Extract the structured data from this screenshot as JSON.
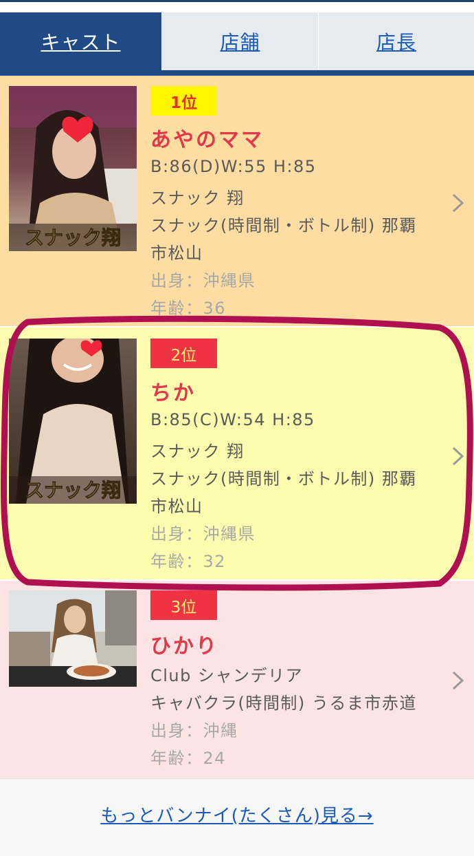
{
  "tabs": [
    {
      "label": "キャスト",
      "active": true
    },
    {
      "label": "店舗",
      "active": false
    },
    {
      "label": "店長",
      "active": false
    }
  ],
  "cast": [
    {
      "rank": "1位",
      "name": "あやのママ",
      "lines": [
        "B:86(D)W:55 H:85",
        "スナック 翔",
        "スナック(時間制・ボトル制) 那覇",
        "市松山"
      ],
      "origin": "出身：沖縄県",
      "age": "年齢：36",
      "watermark": "スナック翔"
    },
    {
      "rank": "2位",
      "name": "ちか",
      "lines": [
        "B:85(C)W:54 H:85",
        "スナック 翔",
        "スナック(時間制・ボトル制) 那覇",
        "市松山"
      ],
      "origin": "出身：沖縄県",
      "age": "年齢：32",
      "watermark": "スナック翔"
    },
    {
      "rank": "3位",
      "name": "ひかり",
      "lines": [
        "Club シャンデリア",
        "キャバクラ(時間制) うるま市赤道"
      ],
      "origin": "出身：沖縄",
      "age": "年齢：24"
    }
  ],
  "more": {
    "label": "もっとバンナイ(たくさん)見る→"
  },
  "colors": {
    "tab_active": "#1f4a85",
    "rank1_bg": "#fedda2",
    "rank2_bg": "#fefdaf",
    "rank3_bg": "#fbe4e3",
    "highlight": "#b0104f",
    "name": "#e03a4a"
  },
  "icons": [
    "chevron-right-icon",
    "heart-sticker-icon"
  ]
}
